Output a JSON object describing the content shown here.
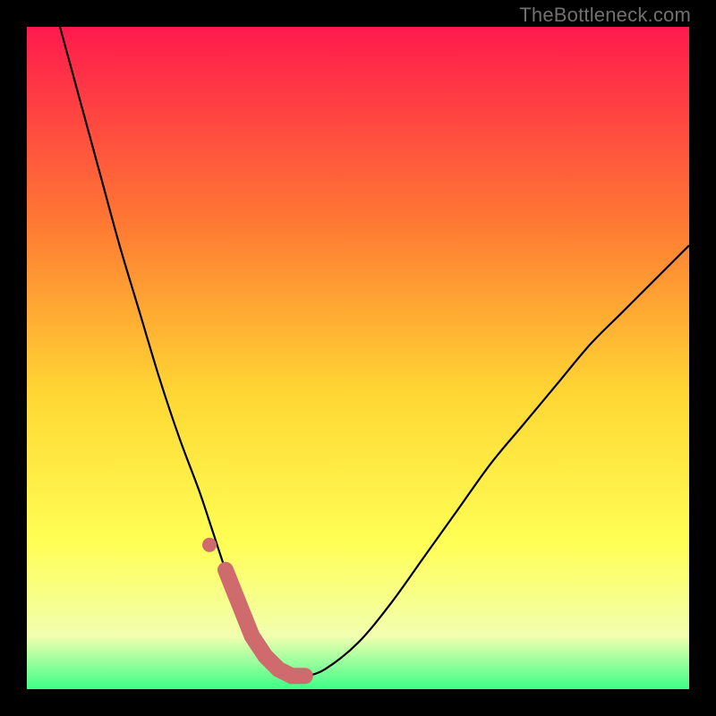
{
  "watermark": "TheBottleneck.com",
  "colors": {
    "black": "#000000",
    "curve": "#000000",
    "highlight": "#cf6a6d",
    "grad_top": "#ff1a4d",
    "grad_mid1": "#ff7a33",
    "grad_mid2": "#ffd633",
    "grad_mid3": "#ffff55",
    "grad_mid4": "#f2ffb0",
    "grad_bottom": "#3cff87"
  },
  "chart_data": {
    "type": "line",
    "title": "",
    "xlabel": "",
    "ylabel": "",
    "xlim": [
      0,
      100
    ],
    "ylim": [
      0,
      100
    ],
    "series": [
      {
        "name": "bottleneck-curve",
        "x": [
          5,
          8,
          11,
          14,
          17,
          20,
          23,
          26,
          28,
          30,
          32,
          34,
          36,
          38,
          40,
          42,
          45,
          50,
          55,
          60,
          65,
          70,
          75,
          80,
          85,
          90,
          95,
          100
        ],
        "y": [
          100,
          89,
          78,
          67,
          57,
          47,
          38,
          30,
          24,
          18,
          13,
          8,
          5,
          3,
          2,
          2,
          3,
          7,
          13,
          20,
          27,
          34,
          40,
          46,
          52,
          57,
          62,
          67
        ]
      }
    ],
    "annotations": [
      {
        "name": "highlight-min",
        "x_range": [
          30,
          43
        ],
        "y": 2
      }
    ]
  }
}
